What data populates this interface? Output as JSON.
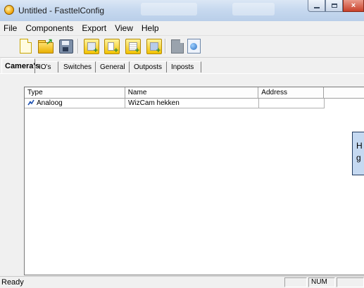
{
  "window": {
    "title": "Untitled - FasttelConfig",
    "controls": {
      "minimize": "minimize",
      "maximize": "maximize",
      "close": "×"
    }
  },
  "menu": [
    "File",
    "Components",
    "Export",
    "View",
    "Help"
  ],
  "toolbar": {
    "buttons": [
      {
        "icon": "new-document-icon"
      },
      {
        "icon": "open-folder-icon"
      },
      {
        "icon": "save-icon"
      },
      {
        "icon": "add-camera-icon"
      },
      {
        "icon": "add-io-icon"
      },
      {
        "icon": "add-switch-icon"
      },
      {
        "icon": "add-outpost-icon"
      },
      {
        "icon": "gray-document-icon"
      },
      {
        "icon": "globe-export-icon"
      }
    ]
  },
  "tabs": [
    "Camera's",
    "IO's",
    "Switches",
    "General",
    "Outposts",
    "Inposts"
  ],
  "active_tab": "Camera's",
  "list": {
    "columns": [
      "Type",
      "Name",
      "Address",
      ""
    ],
    "rows": [
      {
        "type": "Analoog",
        "name": "WizCam hekken",
        "address": "",
        "icon": "camera-type-icon"
      }
    ]
  },
  "overlay": {
    "line1": "H",
    "line2": "g"
  },
  "status": {
    "text": "Ready",
    "num": "NUM"
  },
  "colors": {
    "titlebar": "#c7d9ef",
    "overlay_bg": "#c5d9f1",
    "close": "#c8412a"
  }
}
